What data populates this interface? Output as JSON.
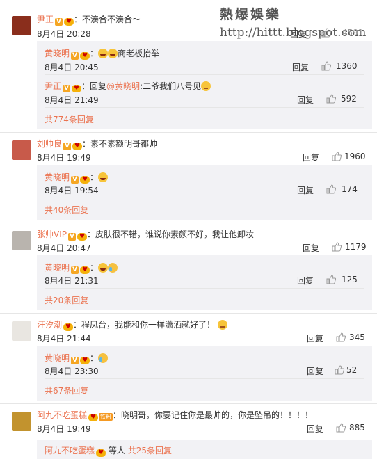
{
  "watermark": {
    "line1": "熱爆娛樂",
    "line2": "http://hittt.blogspot.com"
  },
  "reply_label": "回复",
  "threads": [
    {
      "user": "尹正",
      "text": "：不湊合不湊合～",
      "date": "8月4日 20:28",
      "likes": "4591",
      "replies": [
        {
          "user": "黄晓明",
          "text": "商老板抬举",
          "date": "8月4日 20:45",
          "likes": "1360"
        },
        {
          "user": "尹正",
          "text_prefix": "：回复",
          "mention": "@黄晓明",
          "text": ":二爷我们八号见",
          "date": "8月4日 21:49",
          "likes": "592"
        }
      ],
      "more": "共774条回复"
    },
    {
      "user": "刘帅良",
      "text": "：素不素额明哥都帅",
      "date": "8月4日 19:49",
      "likes": "1960",
      "replies": [
        {
          "user": "黄晓明",
          "text": "：",
          "date": "8月4日 19:54",
          "likes": "174"
        }
      ],
      "more": "共40条回复"
    },
    {
      "user": "张帅VIP",
      "text": "：皮肤很不错，谁说你素颜不好，我让他卸妆",
      "date": "8月4日 20:47",
      "likes": "1179",
      "replies": [
        {
          "user": "黄晓明",
          "text": "：",
          "date": "8月4日 21:31",
          "likes": "125"
        }
      ],
      "more": "共20条回复"
    },
    {
      "user": "汪汐潮",
      "text": "：程凤台，我能和你一样潇洒就好了！",
      "date": "8月4日 21:44",
      "likes": "345",
      "replies": [
        {
          "user": "黄晓明",
          "text": "：",
          "date": "8月4日 23:30",
          "likes": "52"
        }
      ],
      "more": "共67条回复"
    },
    {
      "user": "阿九不吃蛋糕",
      "fan_badge": "铁粉",
      "text": "：晓明哥，你要记住你是最帅的，你是坠吊的！！！！",
      "date": "8月4日 19:49",
      "likes": "885",
      "footer_user": "阿九不吃蛋糕",
      "footer_text": "等人",
      "more": "共25条回复"
    }
  ],
  "colors": {
    "username": "#eb7350",
    "sub_bg": "#f2f2f5",
    "badge": "#f5a623"
  }
}
